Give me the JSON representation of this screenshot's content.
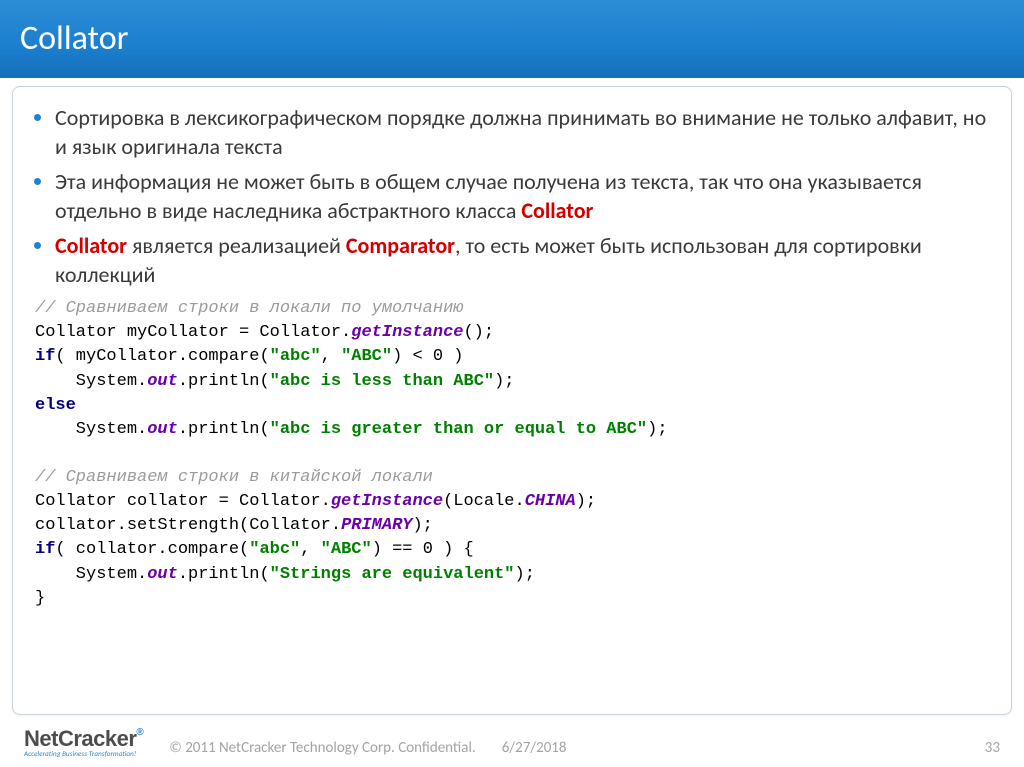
{
  "title": "Collator",
  "bullets": [
    {
      "pre": "Сортировка в лексикографическом порядке должна принимать во внимание не только алфавит, но и язык оригинала текста"
    },
    {
      "pre": "Эта информация не может быть в общем случае получена из текста, так что она указывается отдельно в виде наследника абстрактного класса ",
      "bold": "Collator"
    },
    {
      "bold1": "Collator",
      "mid1": "  является реализацией ",
      "bold2": "Comparator",
      "post": ", то есть может быть использован для сортировки коллекций"
    }
  ],
  "code": {
    "l1": "// Сравниваем строки в локали по умолчанию",
    "l2a": "Collator myCollator = Collator.",
    "l2b": "getInstance",
    "l2c": "();",
    "l3a": "if",
    "l3b": "( myCollator.compare(",
    "l3c": "\"abc\"",
    "l3d": ", ",
    "l3e": "\"ABC\"",
    "l3f": ") < 0 )",
    "l4a": "    System.",
    "l4b": "out",
    "l4c": ".println(",
    "l4d": "\"abc is less than ABC\"",
    "l4e": ");",
    "l5a": "else",
    "l6a": "    System.",
    "l6b": "out",
    "l6c": ".println(",
    "l6d": "\"abc is greater than or equal to ABC\"",
    "l6e": ");",
    "l7": "",
    "l8": "// Сравниваем строки в китайской локали",
    "l9a": "Collator collator = Collator.",
    "l9b": "getInstance",
    "l9c": "(Locale.",
    "l9d": "CHINA",
    "l9e": ");",
    "l10a": "collator.setStrength(Collator.",
    "l10b": "PRIMARY",
    "l10c": ");",
    "l11a": "if",
    "l11b": "( collator.compare(",
    "l11c": "\"abc\"",
    "l11d": ", ",
    "l11e": "\"ABC\"",
    "l11f": ") == 0 ) {",
    "l12a": "    System.",
    "l12b": "out",
    "l12c": ".println(",
    "l12d": "\"Strings are equivalent\"",
    "l12e": ");",
    "l13": "}"
  },
  "footer": {
    "logo_main": "NetCracker",
    "logo_reg": "®",
    "logo_sub": "Accelerating Business Transformation!",
    "copyright": "© 2011 NetCracker Technology Corp. Confidential.",
    "date": "6/27/2018",
    "page": "33"
  }
}
